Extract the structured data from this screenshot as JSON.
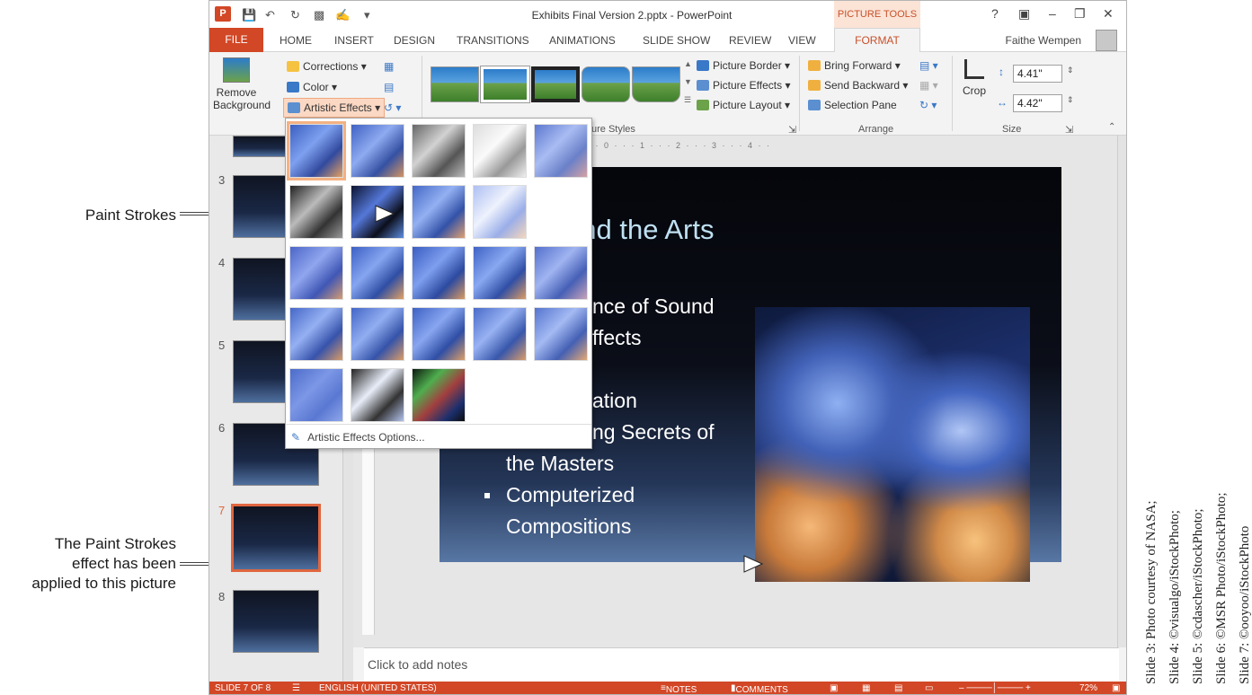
{
  "callouts": {
    "paint_strokes": "Paint Strokes",
    "applied": [
      "The Paint Strokes",
      "effect has been",
      "applied to this picture"
    ]
  },
  "titlebar": {
    "logo": "P",
    "title": "Exhibits Final Version 2.pptx - PowerPoint",
    "contextual": "PICTURE TOOLS",
    "help": "?"
  },
  "tabs": {
    "file": "FILE",
    "items": [
      "HOME",
      "INSERT",
      "DESIGN",
      "TRANSITIONS",
      "ANIMATIONS",
      "SLIDE SHOW",
      "REVIEW",
      "VIEW"
    ],
    "format": "FORMAT",
    "user": "Faithe Wempen"
  },
  "ribbon": {
    "remove_background": [
      "Remove",
      "Background"
    ],
    "corrections": "Corrections",
    "color": "Color",
    "artistic_effects": "Artistic Effects",
    "picture_border": "Picture Border",
    "picture_effects": "Picture Effects",
    "picture_layout": "Picture Layout",
    "picture_styles_label": "ure Styles",
    "bring_forward": "Bring Forward",
    "send_backward": "Send Backward",
    "selection_pane": "Selection Pane",
    "arrange_label": "Arrange",
    "crop": "Crop",
    "height": "4.41\"",
    "width": "4.42\"",
    "size_label": "Size"
  },
  "gallery": {
    "options": "Artistic Effects Options..."
  },
  "thumbs": {
    "numbers": [
      "3",
      "4",
      "5",
      "6",
      "7",
      "8"
    ]
  },
  "slide": {
    "title": "and the Arts",
    "bullets": [
      "nce of Sound",
      "ffects",
      "ation",
      "ng Secrets of",
      "the Masters",
      "Computerized",
      "Compositions"
    ]
  },
  "notes": "Click to add notes",
  "status": {
    "slide": "SLIDE 7 OF 8",
    "language": "ENGLISH (UNITED STATES)",
    "notes": "NOTES",
    "comments": "COMMENTS",
    "zoom": "72%"
  },
  "credits": [
    "Slide 3: Photo courtesy of NASA;",
    "Slide 4: ©visualgo/iStockPhoto;",
    "Slide 5: ©cdascher/iStockPhoto;",
    "Slide 6: ©MSR Photo/iStockPhoto;",
    "Slide 7: ©ooyoo/iStockPhoto"
  ],
  "colors": {
    "accent": "#d24726",
    "contextual": "#c8502a",
    "selection": "#e0663f"
  }
}
